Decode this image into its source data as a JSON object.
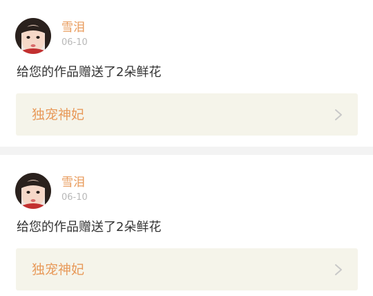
{
  "notifications": [
    {
      "user": "雪泪",
      "date": "06-10",
      "message": "给您的作品赠送了2朵鲜花",
      "work_title": "独宠神妃",
      "avatar_icon": "user-avatar-photo",
      "arrow_icon": "chevron-right-icon"
    },
    {
      "user": "雪泪",
      "date": "06-10",
      "message": "给您的作品赠送了2朵鲜花",
      "work_title": "独宠神妃",
      "avatar_icon": "user-avatar-photo",
      "arrow_icon": "chevron-right-icon"
    }
  ],
  "colors": {
    "accent": "#e89a5a",
    "date_gray": "#b8b8b8",
    "text": "#333333",
    "card_bg": "#f5f4ea",
    "separator": "#f3f3f3"
  }
}
